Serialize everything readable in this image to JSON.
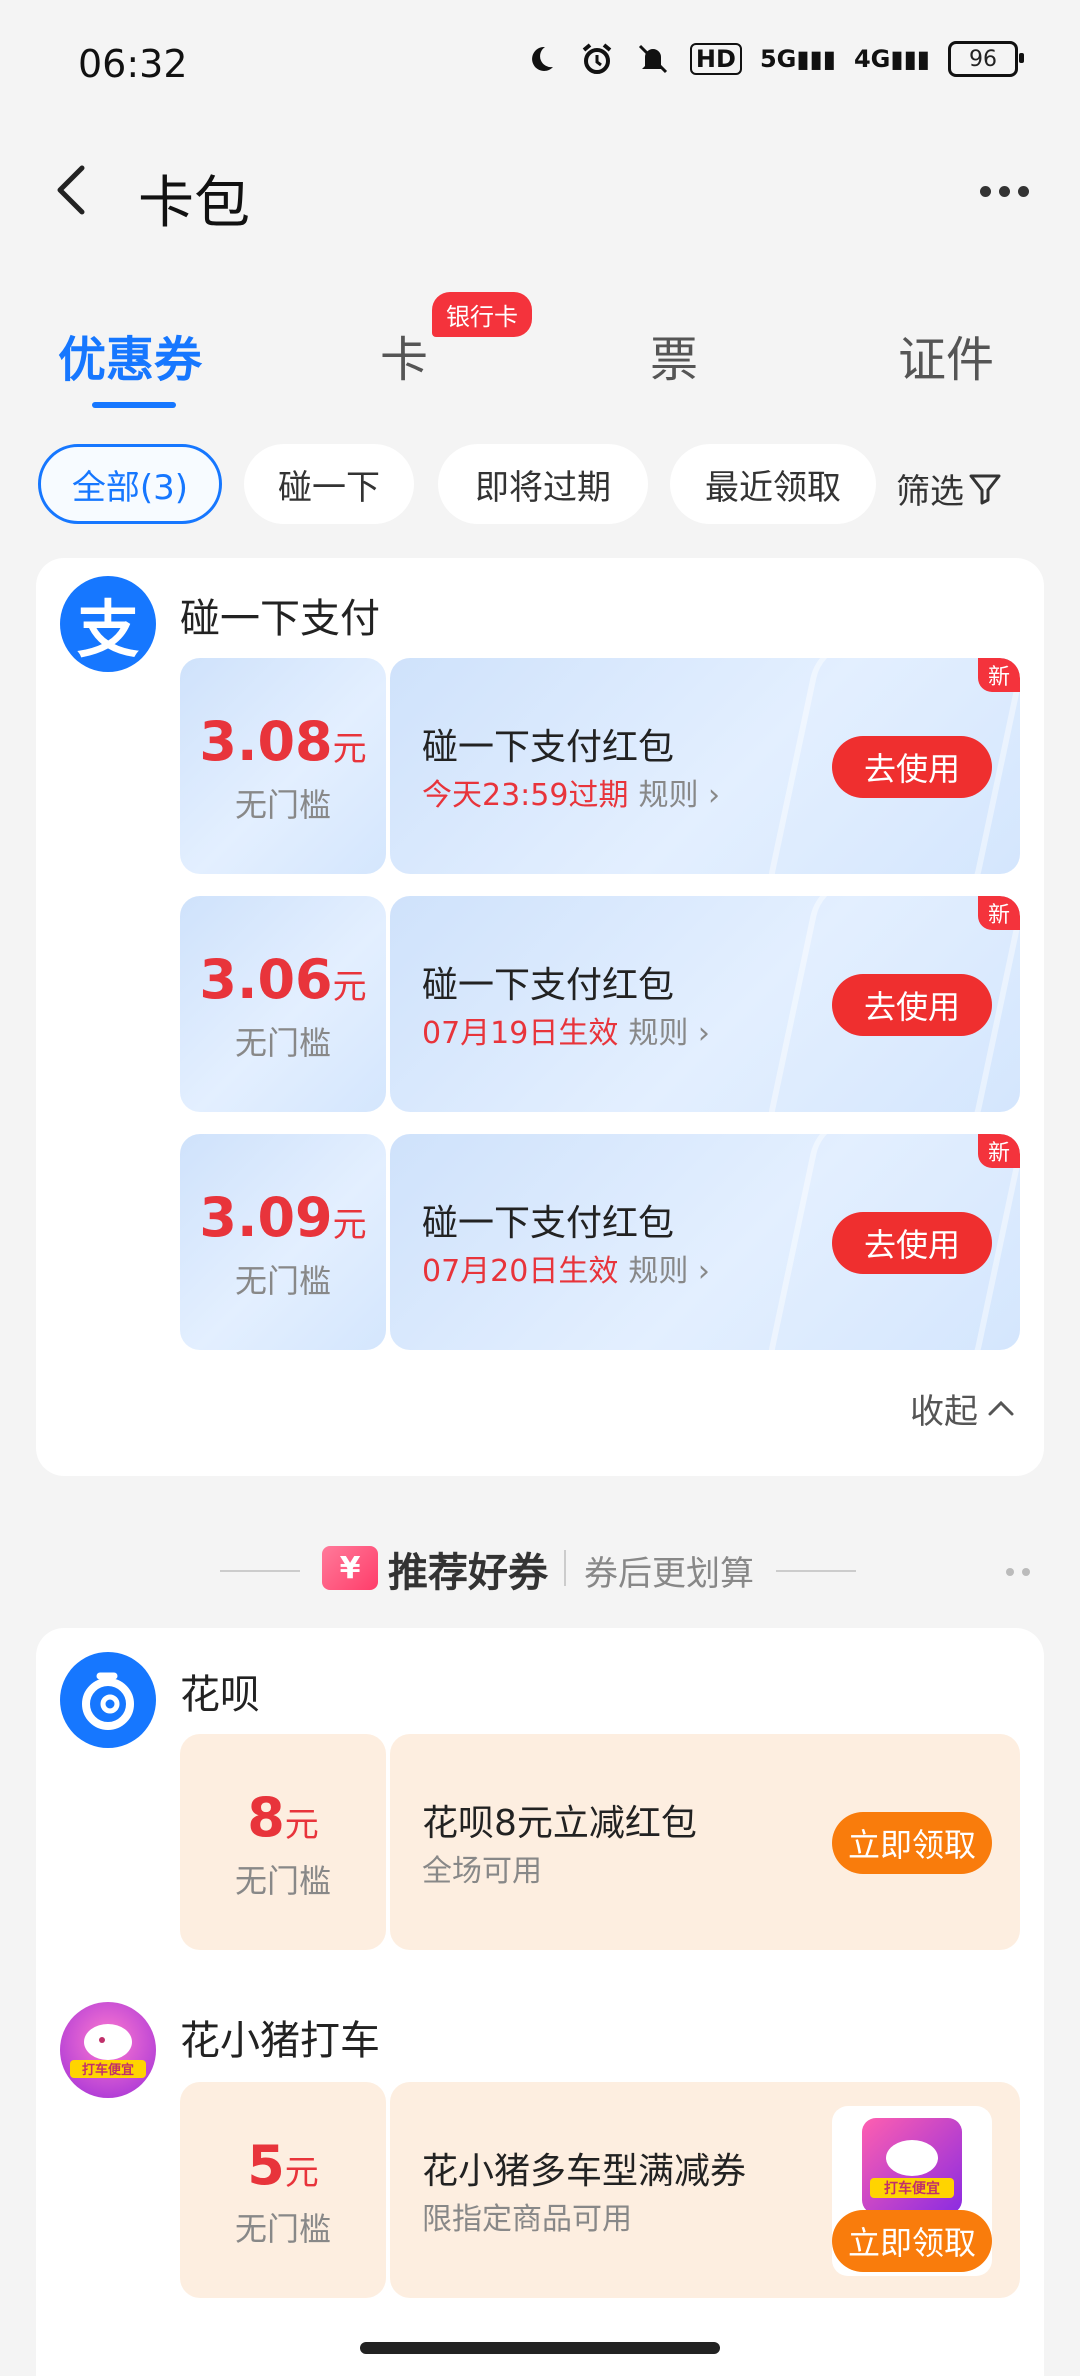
{
  "status": {
    "time": "06:32",
    "hd": "HD",
    "net5g": "5G",
    "net4g": "4G",
    "battery": "96"
  },
  "header": {
    "title": "卡包"
  },
  "tabs": [
    {
      "label": "优惠券"
    },
    {
      "label": "卡"
    },
    {
      "label": "票"
    },
    {
      "label": "证件"
    }
  ],
  "tab_badge": "银行卡",
  "chips": [
    {
      "label": "全部(3)"
    },
    {
      "label": "碰一下"
    },
    {
      "label": "即将过期"
    },
    {
      "label": "最近领取"
    }
  ],
  "filter_label": "筛选",
  "group1": {
    "merchant": "碰一下支付",
    "logo_char": "支",
    "coupons": [
      {
        "amount": "3.08",
        "unit": "元",
        "threshold": "无门槛",
        "title": "碰一下支付红包",
        "status": "今天23:59过期",
        "rule": "规则",
        "button": "去使用",
        "badge": "新"
      },
      {
        "amount": "3.06",
        "unit": "元",
        "threshold": "无门槛",
        "title": "碰一下支付红包",
        "status": "07月19日生效",
        "rule": "规则",
        "button": "去使用",
        "badge": "新"
      },
      {
        "amount": "3.09",
        "unit": "元",
        "threshold": "无门槛",
        "title": "碰一下支付红包",
        "status": "07月20日生效",
        "rule": "规则",
        "button": "去使用",
        "badge": "新"
      }
    ],
    "collapse_label": "收起"
  },
  "recommend": {
    "icon_char": "¥",
    "title": "推荐好券",
    "subtitle": "券后更划算"
  },
  "group2": {
    "merchants": [
      {
        "name": "花呗",
        "coupon": {
          "amount": "8",
          "unit": "元",
          "threshold": "无门槛",
          "title": "花呗8元立减红包",
          "sub": "全场可用",
          "button": "立即领取"
        }
      },
      {
        "name": "花小猪打车",
        "logo_text": "打车便宜",
        "coupon": {
          "amount": "5",
          "unit": "元",
          "threshold": "无门槛",
          "title": "花小猪多车型满减券",
          "sub": "限指定商品可用",
          "button": "立即领取"
        }
      }
    ]
  },
  "colors": {
    "accent": "#1677ff",
    "red": "#e8343b",
    "orange": "#f97c0c"
  }
}
